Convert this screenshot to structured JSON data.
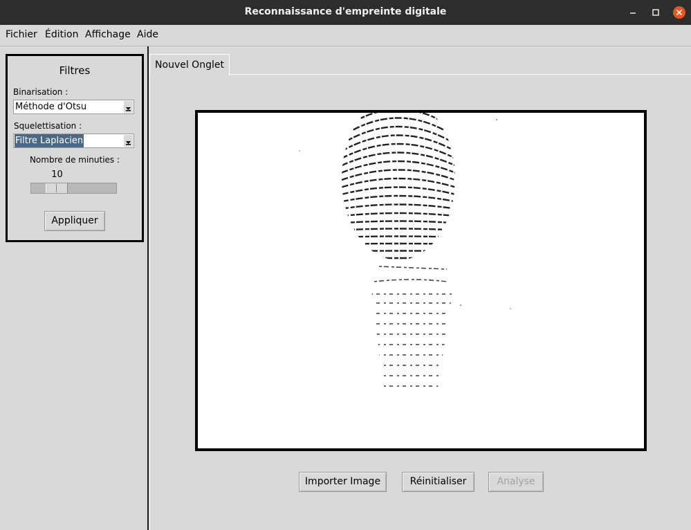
{
  "window": {
    "title": "Reconnaissance d'empreinte digitale"
  },
  "menu": {
    "items": [
      "Fichier",
      "Édition",
      "Affichage",
      "Aide"
    ]
  },
  "filters": {
    "title": "Filtres",
    "binarisation_label": "Binarisation :",
    "binarisation_value": "Méthode d'Otsu",
    "squelettisation_label": "Squelettisation :",
    "squelettisation_value": "Filtre Laplacien",
    "minuties_label": "Nombre de minuties :",
    "minuties_value": "10",
    "apply_label": "Appliquer"
  },
  "tabs": [
    {
      "label": "Nouvel Onglet"
    }
  ],
  "actions": {
    "import_label": "Importer Image",
    "reset_label": "Réinitialiser",
    "analyse_label": "Analyse"
  },
  "colors": {
    "titlebar": "#2d2d2d",
    "close_button": "#e95420",
    "panel_bg": "#d9d9d9",
    "selection": "#4a6984"
  }
}
